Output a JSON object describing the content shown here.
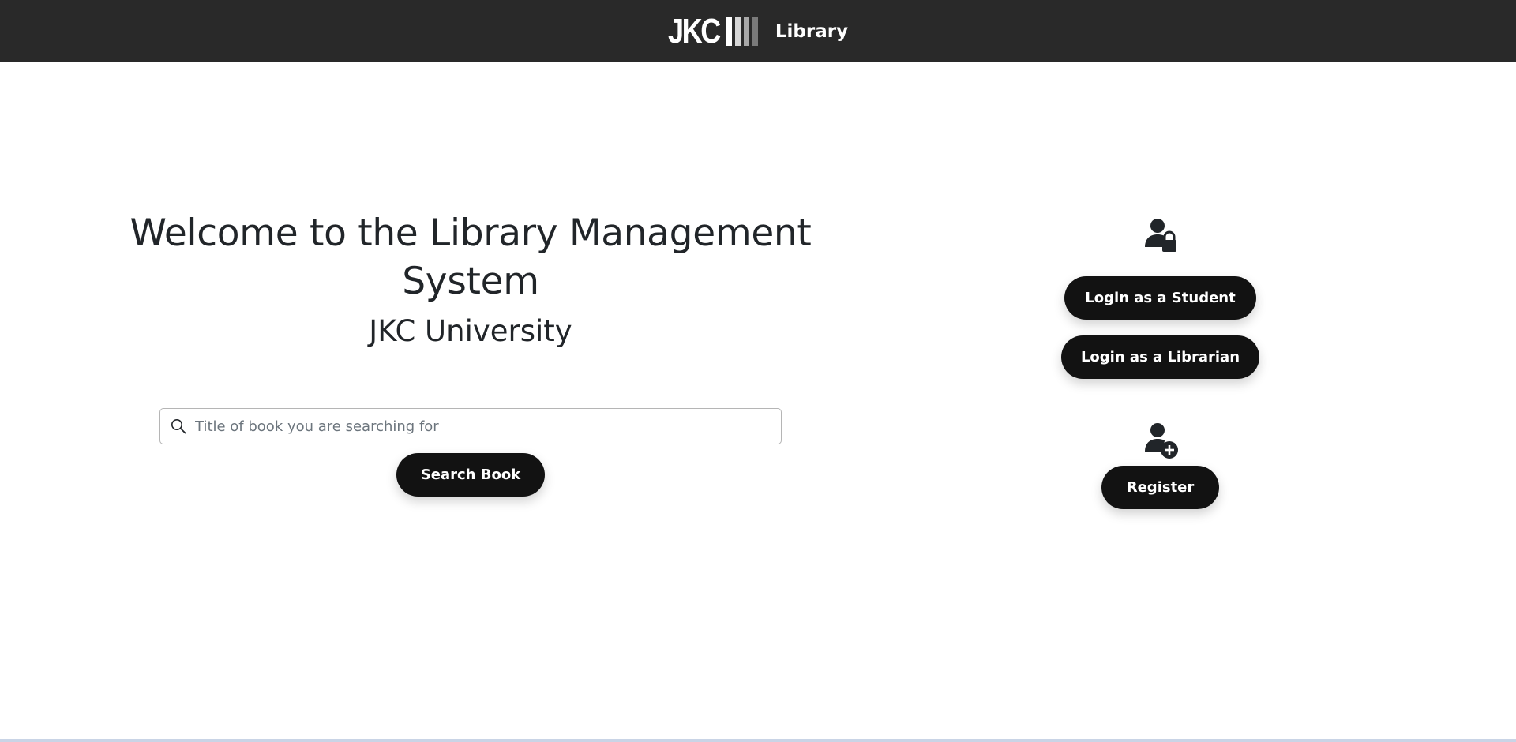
{
  "navbar": {
    "logo_text": "JKC",
    "brand_label": "Library",
    "background": "#292929"
  },
  "hero": {
    "title": "Welcome to the Library Management System",
    "subtitle": "JKC University"
  },
  "search": {
    "icon": "search-icon",
    "placeholder": "Title of book you are searching for",
    "value": "",
    "button_label": "Search Book"
  },
  "auth": {
    "login_icon": "user-lock-icon",
    "student_button": "Login as a Student",
    "librarian_button": "Login as a Librarian",
    "register_icon": "user-plus-icon",
    "register_button": "Register"
  },
  "colors": {
    "button": "#121212",
    "text": "#212529",
    "accent_line": "#c9d4e6"
  }
}
